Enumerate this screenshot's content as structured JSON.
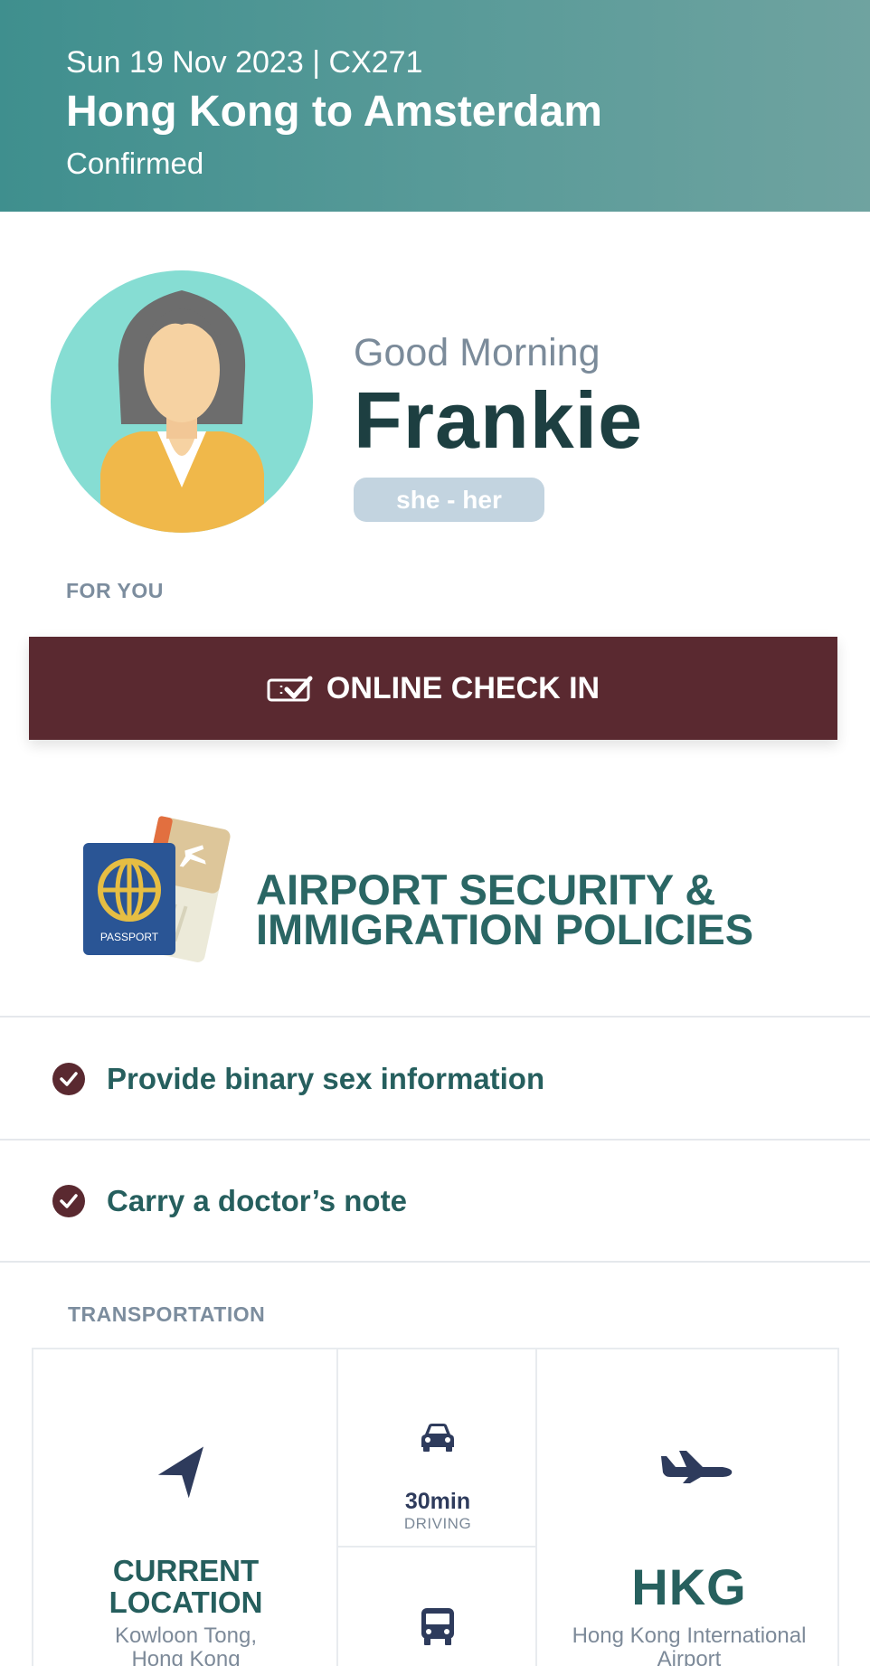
{
  "header": {
    "date_flight": "Sun 19 Nov 2023 | CX271",
    "route": "Hong Kong to Amsterdam",
    "status": "Confirmed"
  },
  "profile": {
    "greeting": "Good Morning",
    "name": "Frankie",
    "pronouns": "she - her",
    "avatar_icon": "female-avatar-icon"
  },
  "for_you": {
    "label": "FOR YOU",
    "checkin_label": "ONLINE CHECK IN",
    "checkin_icon": "ticket-check-icon"
  },
  "policies": {
    "title_line1": "AIRPORT SECURITY &",
    "title_line2": "IMMIGRATION POLICIES",
    "icon": "passport-boarding-pass-icon",
    "passport_text": "PASSPORT",
    "items": [
      {
        "text": "Provide binary sex information",
        "icon": "check-circle-icon"
      },
      {
        "text": "Carry a doctor’s note",
        "icon": "check-circle-icon"
      }
    ]
  },
  "transportation": {
    "label": "TRANSPORTATION",
    "origin": {
      "title_line1": "CURRENT",
      "title_line2": "LOCATION",
      "sub_line1": "Kowloon Tong,",
      "sub_line2": "Hong Kong",
      "icon": "navigation-arrow-icon"
    },
    "options": [
      {
        "time": "30min",
        "mode": "DRIVING",
        "icon": "car-icon"
      },
      {
        "icon": "bus-icon"
      }
    ],
    "destination": {
      "code": "HKG",
      "name_line1": "Hong Kong International",
      "name_line2": "Airport",
      "icon": "airplane-icon"
    }
  },
  "colors": {
    "header_teal": "#3f8f8e",
    "checkin_maroon": "#5a2930",
    "title_teal": "#2a6664",
    "navy_icons": "#2e3b5c"
  }
}
